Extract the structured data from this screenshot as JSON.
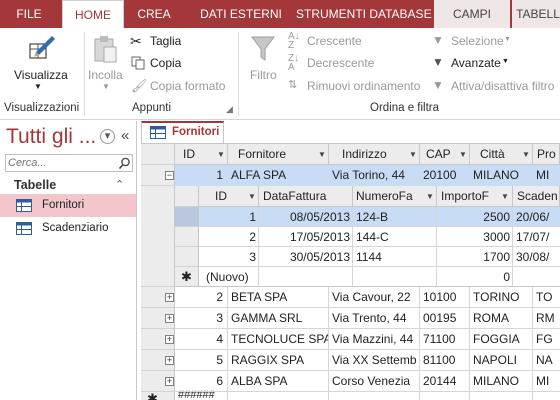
{
  "ribbon_tabs": [
    "FILE",
    "HOME",
    "CREA",
    "DATI ESTERNI",
    "STRUMENTI DATABASE",
    "CAMPI",
    "TABELLA"
  ],
  "active_tab": "HOME",
  "accent_color": "#a4373a",
  "ribbon": {
    "visualizza": "Visualizza",
    "incolla": "Incolla",
    "taglia": "Taglia",
    "copia": "Copia",
    "copia_formato": "Copia formato",
    "filtro": "Filtro",
    "crescente": "Crescente",
    "decrescente": "Decrescente",
    "rimuovi_ordinamento": "Rimuovi ordinamento",
    "selezione": "Selezione",
    "avanzate": "Avanzate",
    "attiva_disattiva_filtro": "Attiva/disattiva filtro",
    "group_visualizzazioni": "Visualizzazioni",
    "group_appunti": "Appunti",
    "group_ordina": "Ordina e filtra"
  },
  "nav": {
    "title": "Tutti gli ...",
    "search_placeholder": "Cerca...",
    "section": "Tabelle",
    "items": [
      "Fornitori",
      "Scadenziario"
    ],
    "selected": "Fornitori"
  },
  "document_tab": "Fornitori",
  "table": {
    "columns": [
      "ID",
      "Fornitore",
      "Indirizzo",
      "CAP",
      "Città",
      "Pro"
    ],
    "rows": [
      {
        "id": "1",
        "fornitore": "ALFA SPA",
        "indirizzo": "Via Torino, 44",
        "cap": "20100",
        "citta": "MILANO",
        "prov": "MI"
      },
      {
        "id": "2",
        "fornitore": "BETA SPA",
        "indirizzo": "Via Cavour, 22",
        "cap": "10100",
        "citta": "TORINO",
        "prov": "TO"
      },
      {
        "id": "3",
        "fornitore": "GAMMA SRL",
        "indirizzo": "Via Trento, 44",
        "cap": "00195",
        "citta": "ROMA",
        "prov": "RM"
      },
      {
        "id": "4",
        "fornitore": "TECNOLUCE SPA",
        "indirizzo": "Via Mazzini, 44",
        "cap": "71100",
        "citta": "FOGGIA",
        "prov": "FG"
      },
      {
        "id": "5",
        "fornitore": "RAGGIX SPA",
        "indirizzo": "Via XX Settemb",
        "cap": "81100",
        "citta": "NAPOLI",
        "prov": "NA"
      },
      {
        "id": "6",
        "fornitore": "ALBA SPA",
        "indirizzo": "Corso Venezia",
        "cap": "20144",
        "citta": "MILANO",
        "prov": "MI"
      }
    ],
    "new_row_marker": "######"
  },
  "subtable": {
    "columns": [
      "ID",
      "DataFattura",
      "NumeroFa",
      "ImportoF",
      "Scaden"
    ],
    "rows": [
      {
        "id": "1",
        "data": "08/05/2013",
        "numero": "124-B",
        "importo": "2500",
        "scadenza": "20/06/"
      },
      {
        "id": "2",
        "data": "17/05/2013",
        "numero": "144-C",
        "importo": "3000",
        "scadenza": "17/07/"
      },
      {
        "id": "3",
        "data": "30/05/2013",
        "numero": "1144",
        "importo": "1700",
        "scadenza": "30/08/"
      }
    ],
    "new_row": {
      "label": "(Nuovo)",
      "importo": "0"
    }
  }
}
